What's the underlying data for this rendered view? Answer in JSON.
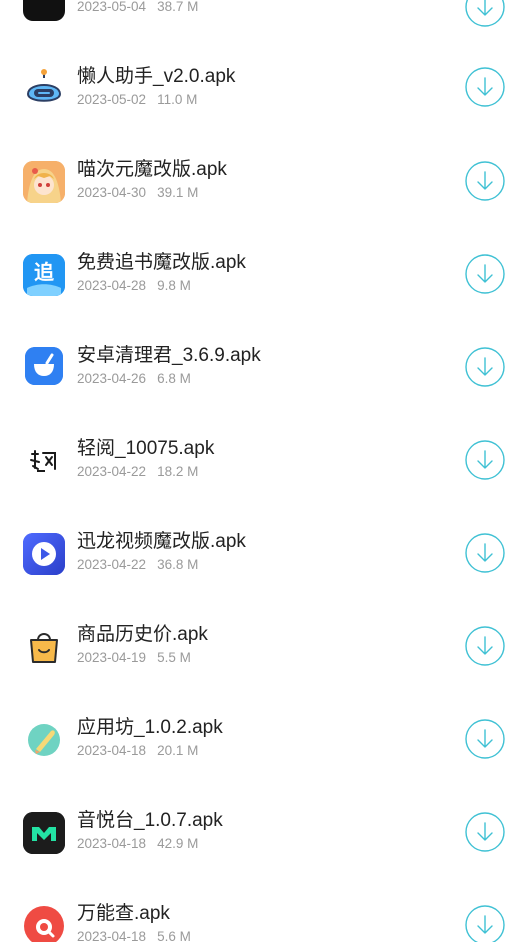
{
  "accent_color": "#3fc1d4",
  "files": [
    {
      "name": "",
      "date": "2023-05-04",
      "size": "38.7 M",
      "icon": "yellow-app-icon"
    },
    {
      "name": "懒人助手_v2.0.apk",
      "date": "2023-05-02",
      "size": "11.0 M",
      "icon": "robot-icon"
    },
    {
      "name": "喵次元魔改版.apk",
      "date": "2023-04-30",
      "size": "39.1 M",
      "icon": "anime-girl-icon"
    },
    {
      "name": "免费追书魔改版.apk",
      "date": "2023-04-28",
      "size": "9.8 M",
      "icon": "zhui-book-icon"
    },
    {
      "name": "安卓清理君_3.6.9.apk",
      "date": "2023-04-26",
      "size": "6.8 M",
      "icon": "cleaner-icon"
    },
    {
      "name": "轻阅_10075.apk",
      "date": "2023-04-22",
      "size": "18.2 M",
      "icon": "qingyue-calligraphy-icon"
    },
    {
      "name": "迅龙视频魔改版.apk",
      "date": "2023-04-22",
      "size": "36.8 M",
      "icon": "play-icon"
    },
    {
      "name": "商品历史价.apk",
      "date": "2023-04-19",
      "size": "5.5 M",
      "icon": "shopping-bag-icon"
    },
    {
      "name": "应用坊_1.0.2.apk",
      "date": "2023-04-18",
      "size": "20.1 M",
      "icon": "app-workshop-icon"
    },
    {
      "name": "音悦台_1.0.7.apk",
      "date": "2023-04-18",
      "size": "42.9 M",
      "icon": "m-logo-icon"
    },
    {
      "name": "万能查.apk",
      "date": "2023-04-18",
      "size": "5.6 M",
      "icon": "search-shield-icon"
    }
  ]
}
